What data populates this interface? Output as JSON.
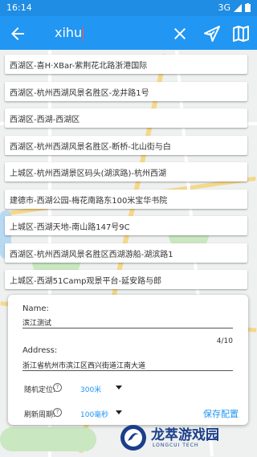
{
  "statusbar": {
    "time": "16:14",
    "network": "3G"
  },
  "search": {
    "query": "xihu"
  },
  "suggestions": [
    "西湖区-喜H·XBar-紫荆花北路浙港国际",
    "西湖区-杭州西湖风景名胜区-龙井路1号",
    "西湖区-西湖-西湖区",
    "西湖区-杭州西湖风景名胜区-断桥-北山街与白",
    "上城区-杭州西湖景区码头(湖滨路)-杭州西湖",
    "建德市-西湖公园-梅花南路东100米宝华书院",
    "上城区-西湖天地-南山路147号9C",
    "西湖区-杭州西湖风景名胜区西湖游船-湖滨路1",
    "上城区-西湖51Camp观景平台-延安路与郎"
  ],
  "panel": {
    "name_label": "Name:",
    "name_value": "滨江测试",
    "counter": "4/10",
    "address_label": "Address:",
    "address_value": "浙江省杭州市滨江区西兴街道江南大道",
    "random_label": "随机定位:",
    "random_help": "?",
    "random_value": "300米",
    "refresh_label": "刷新周期:",
    "refresh_help": "?",
    "refresh_value": "100毫秒",
    "save_label": "保存配置"
  },
  "watermark": {
    "title": "龙萃游戏园",
    "subtitle": "LONGCUI TECH"
  },
  "colors": {
    "primary": "#2196f3",
    "status": "#1f8de4"
  }
}
